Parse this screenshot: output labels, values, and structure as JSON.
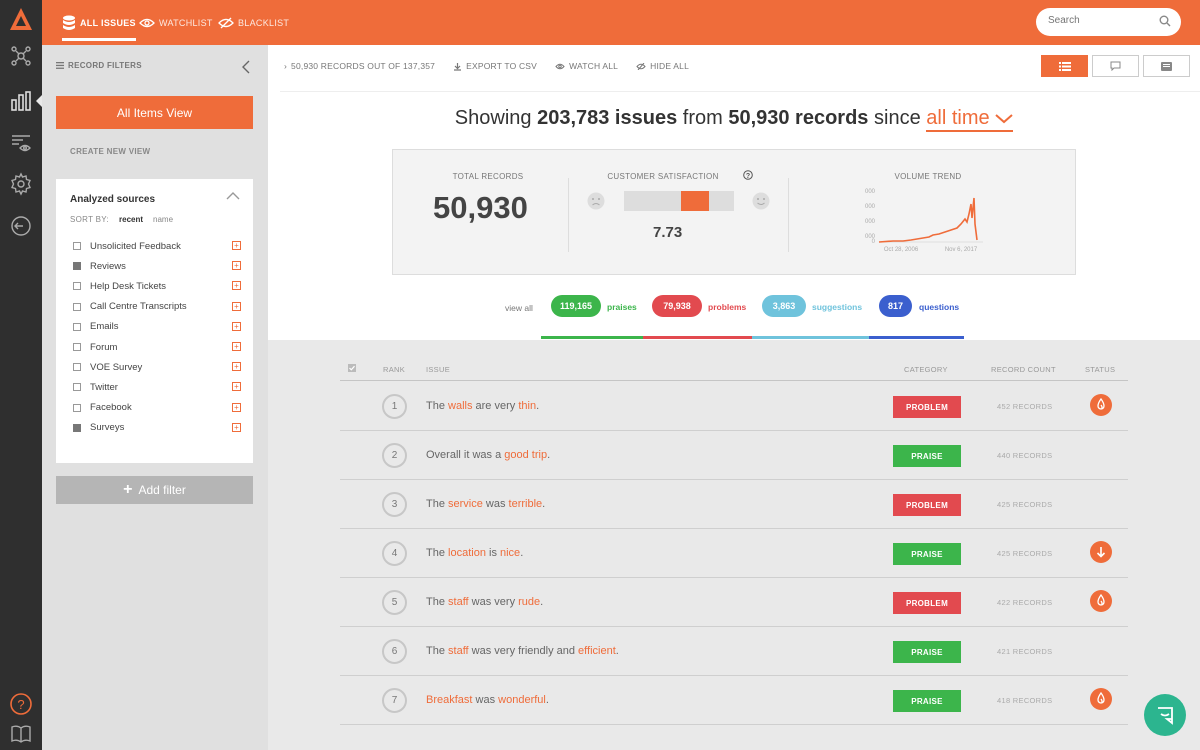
{
  "nav": {
    "tabs": [
      {
        "label": "ALL ISSUES",
        "icon": "database-icon"
      },
      {
        "label": "WATCHLIST",
        "icon": "eye-icon"
      },
      {
        "label": "BLACKLIST",
        "icon": "eye-off-icon"
      }
    ],
    "search_placeholder": "Search"
  },
  "rail": {
    "icons": [
      "logo-icon",
      "network-icon",
      "bar-chart-icon",
      "list-eye-icon",
      "gear-icon",
      "logout-icon",
      "help-icon",
      "book-icon"
    ],
    "help_glyph": "?"
  },
  "filters": {
    "title": "RECORD FILTERS",
    "all_items_view": "All Items View",
    "create_new_view": "CREATE NEW VIEW",
    "sources_title": "Analyzed sources",
    "sort_by_label": "SORT BY:",
    "sort_options": [
      "recent",
      "name"
    ],
    "sources": [
      {
        "label": "Unsolicited Feedback",
        "checked": false
      },
      {
        "label": "Reviews",
        "checked": true
      },
      {
        "label": "Help Desk Tickets",
        "checked": false
      },
      {
        "label": "Call Centre Transcripts",
        "checked": false
      },
      {
        "label": "Emails",
        "checked": false
      },
      {
        "label": "Forum",
        "checked": false
      },
      {
        "label": "VOE Survey",
        "checked": false
      },
      {
        "label": "Twitter",
        "checked": false
      },
      {
        "label": "Facebook",
        "checked": false
      },
      {
        "label": "Surveys",
        "checked": true
      }
    ],
    "add_filter": "Add filter"
  },
  "toolbar": {
    "records": "50,930 RECORDS OUT OF 137,357",
    "export": "EXPORT TO CSV",
    "watch_all": "WATCH ALL",
    "hide_all": "HIDE ALL"
  },
  "headline": {
    "prefix": "Showing",
    "issues": "203,783 issues",
    "from": "from",
    "records": "50,930 records",
    "since": "since",
    "range": "all time"
  },
  "stats": {
    "total_records_label": "TOTAL RECORDS",
    "total_records": "50,930",
    "satisfaction_label": "CUSTOMER SATISFACTION",
    "satisfaction_help": "?",
    "satisfaction_value": "7.73",
    "satisfaction_fraction": 0.773,
    "volume_label": "VOLUME TREND",
    "volume_y_ticks": [
      "000",
      "000",
      "000",
      "000",
      "0"
    ],
    "volume_x_ticks": [
      "Oct 28, 2006",
      "Nov 6, 2017"
    ]
  },
  "pills": {
    "view_all": "view all",
    "items": [
      {
        "count": "119,165",
        "label": "praises",
        "color": "#3cb54b"
      },
      {
        "count": "79,938",
        "label": "problems",
        "color": "#e24a4f"
      },
      {
        "count": "3,863",
        "label": "suggestions",
        "color": "#6fc3dc"
      },
      {
        "count": "817",
        "label": "questions",
        "color": "#3b5fce"
      }
    ]
  },
  "table": {
    "headers": {
      "rank": "RANK",
      "issue": "ISSUE",
      "category": "CATEGORY",
      "count": "RECORD COUNT",
      "status": "STATUS"
    },
    "rows": [
      {
        "rank": "1",
        "issue": [
          [
            "The ",
            false
          ],
          [
            "walls",
            true
          ],
          [
            " are very ",
            false
          ],
          [
            "thin",
            true
          ],
          [
            ".",
            false
          ]
        ],
        "category": "PROBLEM",
        "count": "452 RECORDS",
        "status": "flame-icon"
      },
      {
        "rank": "2",
        "issue": [
          [
            "Overall it was a ",
            false
          ],
          [
            "good trip",
            true
          ],
          [
            ".",
            false
          ]
        ],
        "category": "PRAISE",
        "count": "440 RECORDS",
        "status": ""
      },
      {
        "rank": "3",
        "issue": [
          [
            "The ",
            false
          ],
          [
            "service",
            true
          ],
          [
            " was ",
            false
          ],
          [
            "terrible",
            true
          ],
          [
            ".",
            false
          ]
        ],
        "category": "PROBLEM",
        "count": "425 RECORDS",
        "status": ""
      },
      {
        "rank": "4",
        "issue": [
          [
            "The ",
            false
          ],
          [
            "location",
            true
          ],
          [
            " is ",
            false
          ],
          [
            "nice",
            true
          ],
          [
            ".",
            false
          ]
        ],
        "category": "PRAISE",
        "count": "425 RECORDS",
        "status": "arrow-down-icon"
      },
      {
        "rank": "5",
        "issue": [
          [
            "The ",
            false
          ],
          [
            "staff",
            true
          ],
          [
            " was very ",
            false
          ],
          [
            "rude",
            true
          ],
          [
            ".",
            false
          ]
        ],
        "category": "PROBLEM",
        "count": "422 RECORDS",
        "status": "flame-icon"
      },
      {
        "rank": "6",
        "issue": [
          [
            "The ",
            false
          ],
          [
            "staff",
            true
          ],
          [
            " was very friendly and ",
            false
          ],
          [
            "efficient",
            true
          ],
          [
            ".",
            false
          ]
        ],
        "category": "PRAISE",
        "count": "421 RECORDS",
        "status": ""
      },
      {
        "rank": "7",
        "issue": [
          [
            "Breakfast",
            true
          ],
          [
            " was ",
            false
          ],
          [
            "wonderful",
            true
          ],
          [
            ".",
            false
          ]
        ],
        "category": "PRAISE",
        "count": "418 RECORDS",
        "status": "flame-icon"
      }
    ]
  },
  "colors": {
    "accent": "#ef6c3a",
    "problem": "#e24a4f",
    "praise": "#3cb54b",
    "chat": "#2cb58f"
  }
}
